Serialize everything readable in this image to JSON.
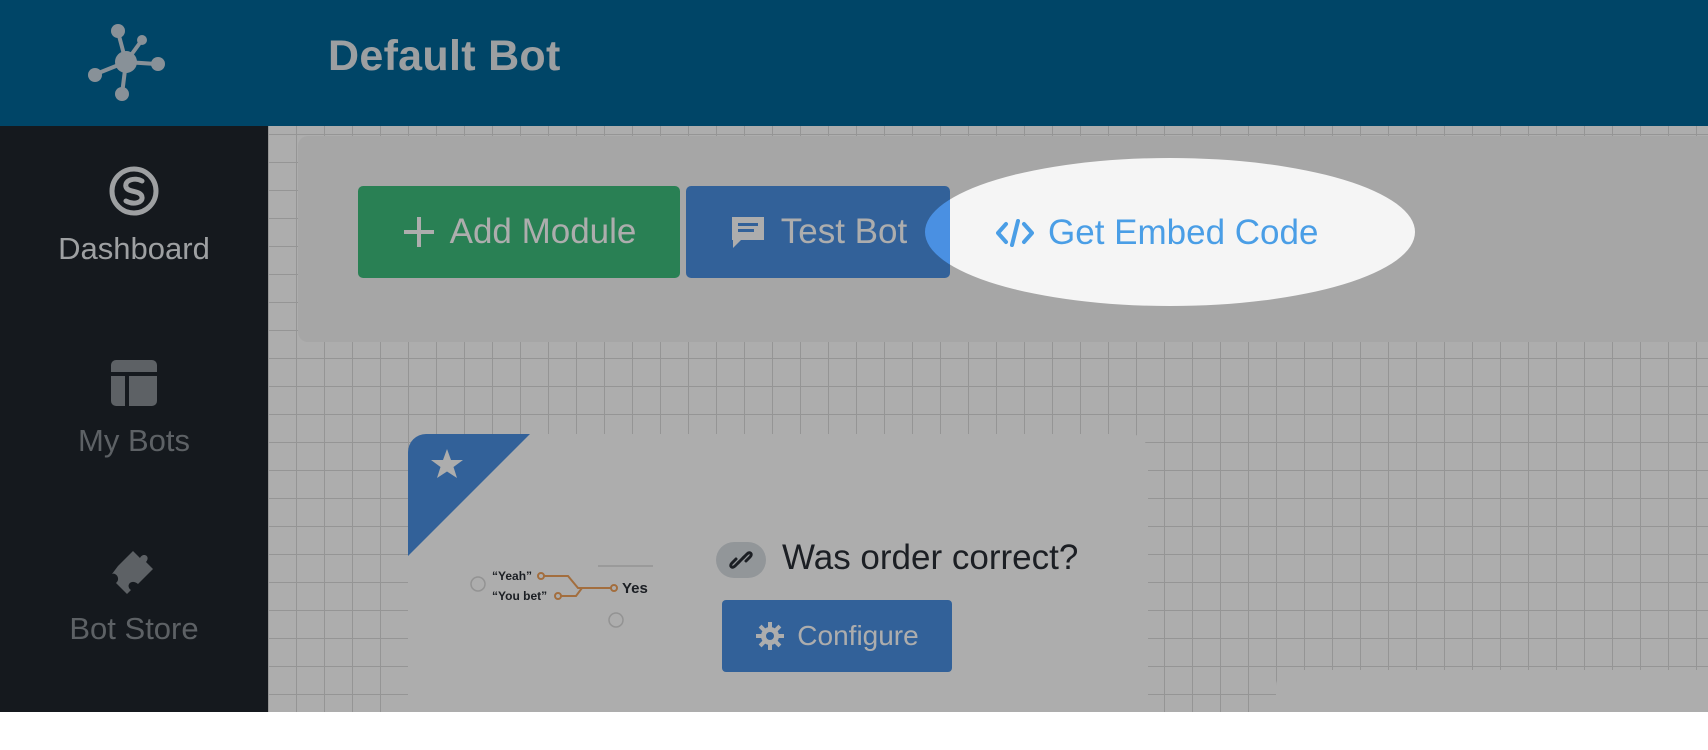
{
  "header": {
    "logo_icon": "molecule-network-icon",
    "title": "Default Bot",
    "background_color": "#006699"
  },
  "sidebar": {
    "background_color": "#1f262d",
    "items": [
      {
        "label": "Dashboard",
        "icon": "dashboard-s-icon",
        "active": true
      },
      {
        "label": "My Bots",
        "icon": "layout-icon",
        "active": false
      },
      {
        "label": "Bot Store",
        "icon": "puzzle-piece-icon",
        "active": false
      }
    ]
  },
  "toolbar": {
    "add_module_label": "Add Module",
    "add_module_icon": "plus-icon",
    "add_module_color": "#3dbd7d",
    "test_bot_label": "Test Bot",
    "test_bot_icon": "chat-bubble-icon",
    "test_bot_color": "#4a90e2",
    "embed_label": "Get Embed Code",
    "embed_icon": "code-brackets-icon",
    "embed_color": "#4a9ee6"
  },
  "module": {
    "title": "Was order correct?",
    "start_icon": "star-icon",
    "link_icon": "link-icon",
    "configure_label": "Configure",
    "configure_icon": "gear-icon",
    "illustration": {
      "inputs": [
        "“Yeah”",
        "“You bet”"
      ],
      "output": "Yes"
    }
  },
  "overlay": {
    "dim_color": "rgba(0,0,0,0.32)",
    "spotlight_target": "Get Embed Code"
  }
}
